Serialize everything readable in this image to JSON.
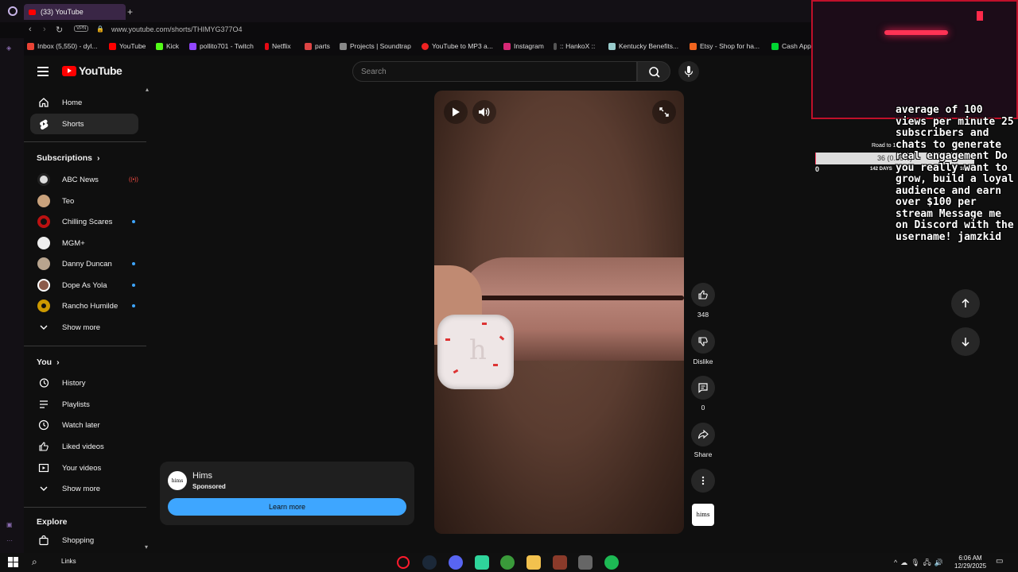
{
  "browser": {
    "tab_title": "(33) YouTube",
    "new_tab": "+",
    "vpn_label": "VPN",
    "url": "www.youtube.com/shorts/THIMYG377O4",
    "bookmarks": [
      {
        "label": "Inbox (5,550) - dyl...",
        "color": "#ea4335"
      },
      {
        "label": "YouTube",
        "color": "#ff0000"
      },
      {
        "label": "Kick",
        "color": "#53fc18"
      },
      {
        "label": "pollito701 - Twitch",
        "color": "#9146ff"
      },
      {
        "label": "Netflix",
        "color": "#e50914"
      },
      {
        "label": "parts",
        "color": "#d44"
      },
      {
        "label": "Projects | Soundtrap",
        "color": "#888"
      },
      {
        "label": "YouTube to MP3 a...",
        "color": "#e22"
      },
      {
        "label": "Instagram",
        "color": "#d62976"
      },
      {
        "label": ":: HankoX ::",
        "color": "#555"
      },
      {
        "label": "Kentucky Benefits...",
        "color": "#9cc"
      },
      {
        "label": "Etsy - Shop for ha...",
        "color": "#f1641e"
      },
      {
        "label": "Cash App",
        "color": "#00d632"
      }
    ]
  },
  "youtube": {
    "logo_text": "YouTube",
    "search_placeholder": "Search",
    "nav": {
      "home": "Home",
      "shorts": "Shorts"
    },
    "subscriptions": {
      "title": "Subscriptions",
      "channels": [
        {
          "name": "ABC News",
          "indicator": "live"
        },
        {
          "name": "Teo",
          "indicator": "none"
        },
        {
          "name": "Chilling Scares",
          "indicator": "dot"
        },
        {
          "name": "MGM+",
          "indicator": "none"
        },
        {
          "name": "Danny Duncan",
          "indicator": "dot"
        },
        {
          "name": "Dope As Yola",
          "indicator": "dot"
        },
        {
          "name": "Rancho Humilde",
          "indicator": "dot"
        }
      ],
      "show_more": "Show more"
    },
    "you": {
      "title": "You",
      "items": [
        "History",
        "Playlists",
        "Watch later",
        "Liked videos",
        "Your videos"
      ],
      "show_more": "Show more"
    },
    "explore": {
      "title": "Explore",
      "items": [
        "Shopping"
      ]
    },
    "actions": {
      "like_count": "348",
      "dislike_label": "Dislike",
      "comments_count": "0",
      "share_label": "Share"
    },
    "ad": {
      "advertiser": "Hims",
      "sponsored": "Sponsored",
      "cta": "Learn more",
      "logo_text": "hims"
    },
    "pill_letter": "h"
  },
  "stream_overlay": {
    "goal_label": "Road to 10...",
    "goal_progress_text": "36 (0.36%)",
    "goal_progress_fraction": 0.0036,
    "goal_min": "0",
    "goal_days": "142 DAYS",
    "goal_max": "10000",
    "message": "average of 100 views per minute 25 subscribers and chats to generate real engagement Do you really want to grow, build a loyal audience and earn over $100 per stream Message me on Discord with the username! jamzkid"
  },
  "taskbar": {
    "links_label": "Links",
    "time": "6:06 AM",
    "date": "12/29/2025"
  },
  "colors": {
    "yt_red": "#ff0000",
    "accent_blue": "#3ea6ff",
    "overlay_red": "#c0102a"
  }
}
